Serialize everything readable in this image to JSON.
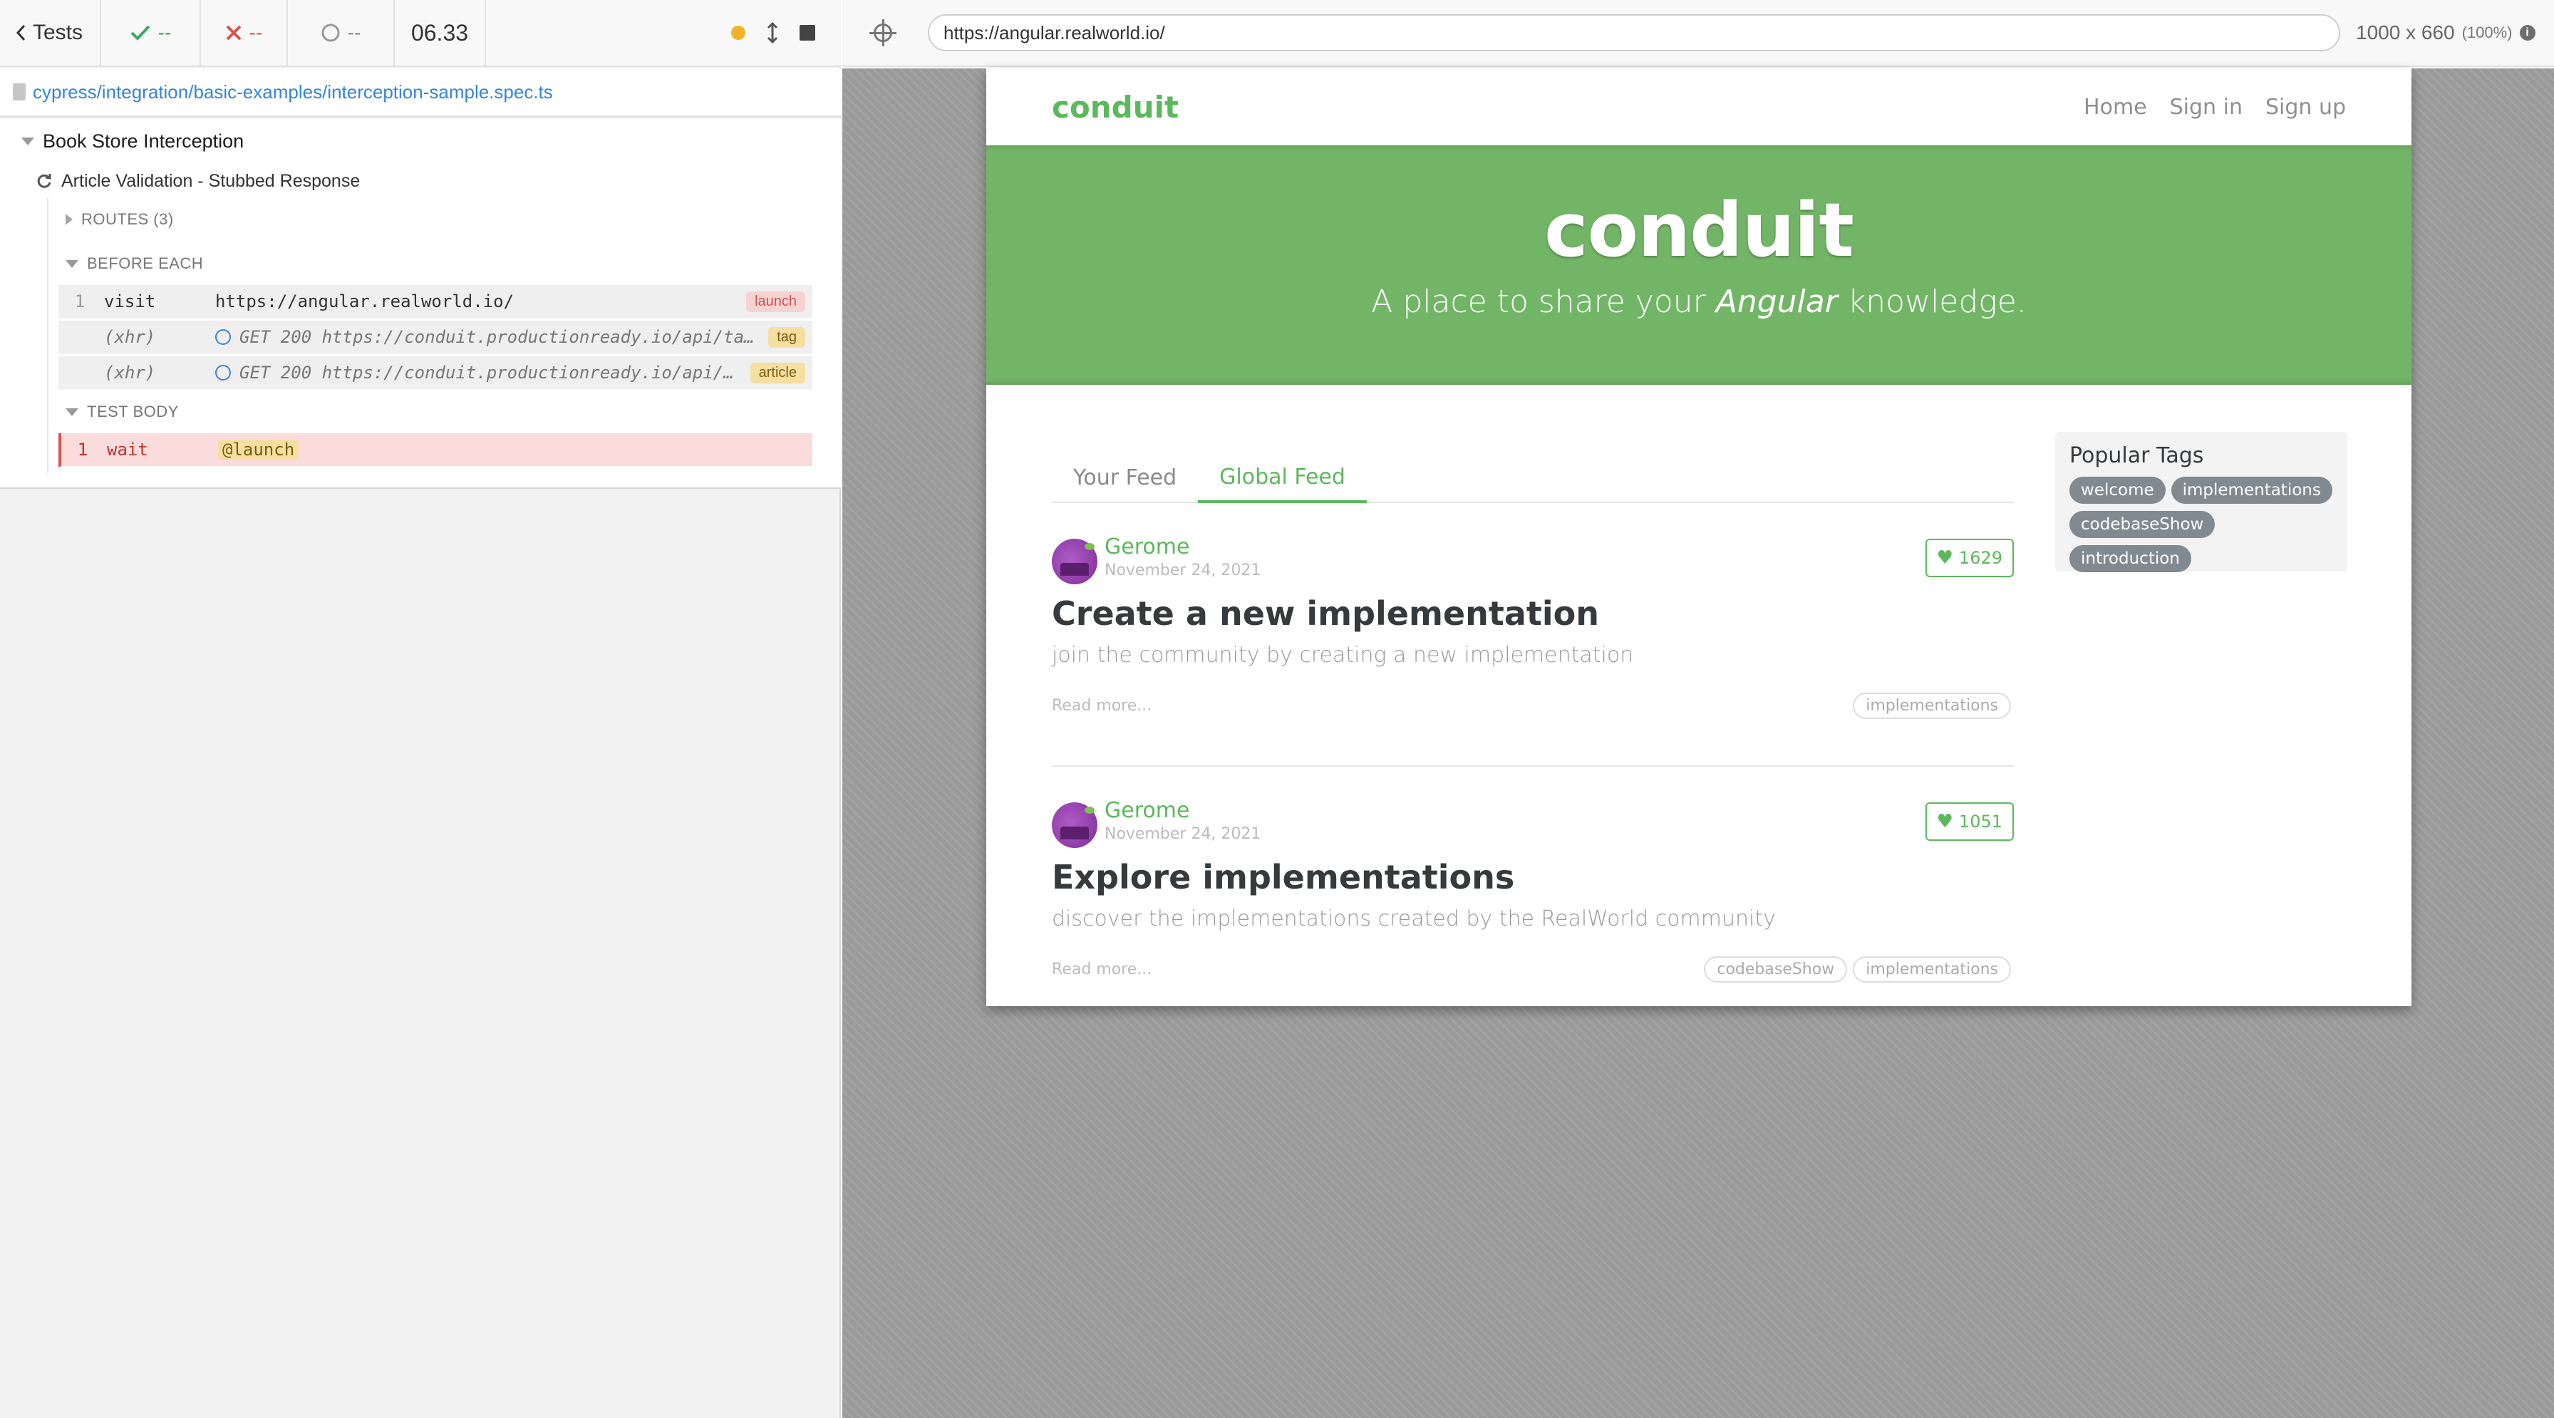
{
  "reporter": {
    "header": {
      "tests_label": "Tests",
      "passed": "--",
      "failed": "--",
      "pending": "--",
      "duration": "06.33"
    },
    "spec_path": "cypress/integration/basic-examples/interception-sample.spec.ts",
    "suite": "Book Store Interception",
    "test": "Article Validation - Stubbed Response",
    "routes_label": "ROUTES (3)",
    "before_each_label": "BEFORE EACH",
    "test_body_label": "TEST BODY",
    "before_each_commands": [
      {
        "num": "1",
        "name": "visit",
        "message": "https://angular.realworld.io/",
        "badge": "launch"
      },
      {
        "num": "",
        "name": "(xhr)",
        "message": "GET 200 https://conduit.productionready.io/api/ta…",
        "badge": "tag"
      },
      {
        "num": "",
        "name": "(xhr)",
        "message": "GET 200 https://conduit.productionready.io/api/…",
        "badge": "article"
      }
    ],
    "test_body_commands": [
      {
        "num": "1",
        "name": "wait",
        "message": "@launch"
      }
    ]
  },
  "aut": {
    "url": "https://angular.realworld.io/",
    "viewport": "1000 x 660",
    "scale": "(100%)"
  },
  "app": {
    "brand": "conduit",
    "nav": [
      "Home",
      "Sign in",
      "Sign up"
    ],
    "banner_title": "conduit",
    "banner_sub_before": "A place to share your ",
    "banner_sub_em": "Angular",
    "banner_sub_after": " knowledge.",
    "tabs": [
      "Your Feed",
      "Global Feed"
    ],
    "articles": [
      {
        "author": "Gerome",
        "date": "November 24, 2021",
        "likes": "1629",
        "title": "Create a new implementation",
        "description": "join the community by creating a new implementation",
        "read_more": "Read more...",
        "tags": [
          "implementations"
        ]
      },
      {
        "author": "Gerome",
        "date": "November 24, 2021",
        "likes": "1051",
        "title": "Explore implementations",
        "description": "discover the implementations created by the RealWorld community",
        "read_more": "Read more...",
        "tags": [
          "codebaseShow",
          "implementations"
        ]
      }
    ],
    "popular_tags_title": "Popular Tags",
    "popular_tags": [
      "welcome",
      "implementations",
      "codebaseShow",
      "introduction"
    ]
  },
  "colors": {
    "conduit_green": "#5cb85c",
    "banner_green": "#73b567",
    "cypress_link": "#3386d6",
    "fail_red": "#d9534f"
  },
  "icons": [
    "chevron-left-icon",
    "check-icon",
    "x-icon",
    "circle-icon",
    "running-dot-icon",
    "resize-icon",
    "stop-icon",
    "file-icon",
    "retry-icon",
    "selector-playground-icon",
    "info-icon",
    "heart-icon"
  ]
}
